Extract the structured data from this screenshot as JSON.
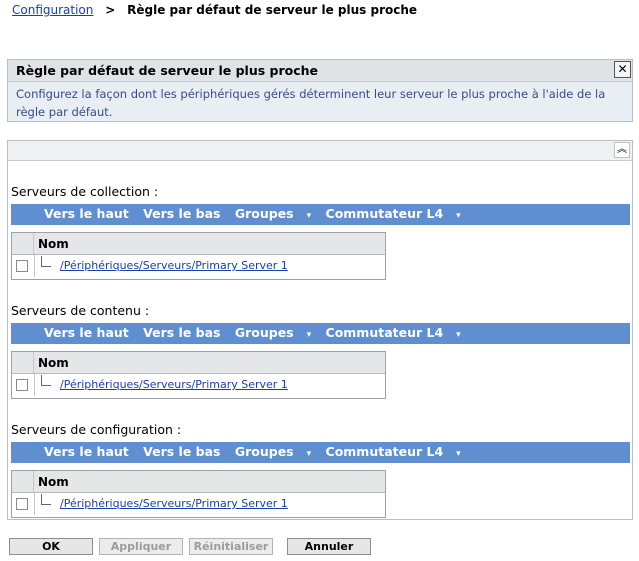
{
  "breadcrumb": {
    "root": "Configuration",
    "separator": ">",
    "current": "Règle par défaut de serveur le plus proche"
  },
  "info": {
    "title": "Règle par défaut de serveur le plus proche",
    "close": "✕",
    "text": "Configurez la façon dont les périphériques gérés déterminent leur serveur le plus proche à l'aide de la règle par défaut."
  },
  "panel": {
    "collapse": "︽"
  },
  "toolbar": {
    "up": "Vers le haut",
    "down": "Vers le bas",
    "groups": "Groupes",
    "switch": "Commutateur L4",
    "dropdown_glyph": "▾"
  },
  "grid": {
    "name_header": "Nom"
  },
  "sections": [
    {
      "label": "Serveurs de collection :",
      "rows": [
        "/Périphériques/Serveurs/Primary Server 1"
      ]
    },
    {
      "label": "Serveurs de contenu :",
      "rows": [
        "/Périphériques/Serveurs/Primary Server 1"
      ]
    },
    {
      "label": "Serveurs de configuration :",
      "rows": [
        "/Périphériques/Serveurs/Primary Server 1"
      ]
    }
  ],
  "buttons": {
    "ok": "OK",
    "apply": "Appliquer",
    "reset": "Réinitialiser",
    "cancel": "Annuler"
  },
  "colors": {
    "toolbar": "#5f8fd0",
    "link": "#1a3fa8",
    "info_text": "#3b4a8a"
  }
}
